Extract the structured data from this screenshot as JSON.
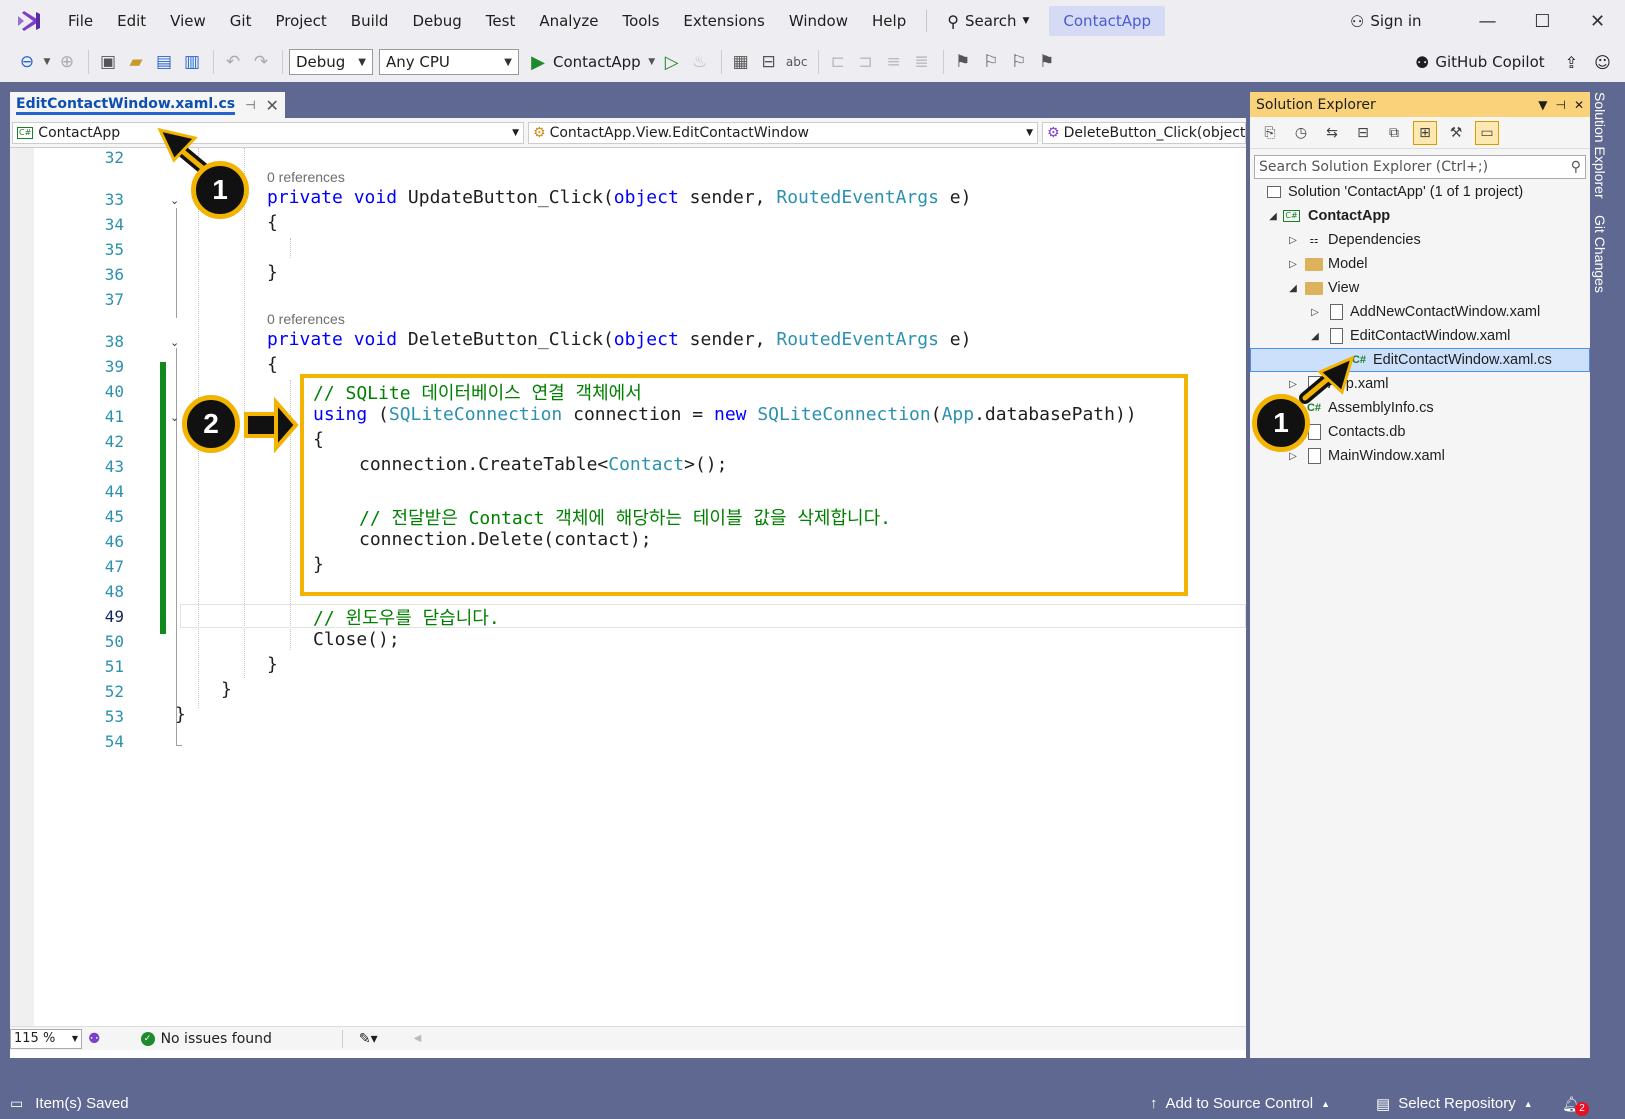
{
  "menu": [
    "File",
    "Edit",
    "View",
    "Git",
    "Project",
    "Build",
    "Debug",
    "Test",
    "Analyze",
    "Tools",
    "Extensions",
    "Window",
    "Help"
  ],
  "search": {
    "label": "Search"
  },
  "app_title": "ContactApp",
  "sign_in": "Sign in",
  "toolbar": {
    "config": "Debug",
    "platform": "Any CPU",
    "run_target": "ContactApp",
    "copilot": "GitHub Copilot"
  },
  "editor": {
    "tab_name": "EditContactWindow.xaml.cs",
    "nav_project": "ContactApp",
    "nav_class": "ContactApp.View.EditContactWindow",
    "nav_member": "DeleteButton_Click(object",
    "references_1": "0 references",
    "references_2": "0 references",
    "line_numbers": [
      "32",
      "33",
      "34",
      "35",
      "36",
      "37",
      "38",
      "39",
      "40",
      "41",
      "42",
      "43",
      "44",
      "45",
      "46",
      "47",
      "48",
      "49",
      "50",
      "51",
      "52",
      "53",
      "54"
    ],
    "lines": {
      "l33_a": "private void ",
      "l33_b": "UpdateButton_Click(",
      "l33_c": "object",
      "l33_d": " sender, ",
      "l33_e": "RoutedEventArgs",
      "l33_f": " e)",
      "l34": "{",
      "l36": "}",
      "l38_a": "private void ",
      "l38_b": "DeleteButton_Click(",
      "l38_c": "object",
      "l38_d": " sender, ",
      "l38_e": "RoutedEventArgs",
      "l38_f": " e)",
      "l39": "{",
      "l40": "// SQLite 데이터베이스 연결 객체에서",
      "l41_a": "using",
      "l41_b": " (",
      "l41_c": "SQLiteConnection",
      "l41_d": " connection = ",
      "l41_e": "new",
      "l41_f": " ",
      "l41_g": "SQLiteConnection",
      "l41_h": "(",
      "l41_i": "App",
      "l41_j": ".databasePath))",
      "l42": "{",
      "l43_a": "connection.CreateTable<",
      "l43_b": "Contact",
      "l43_c": ">();",
      "l45": "// 전달받은 Contact 객체에 해당하는 테이블 값을 삭제합니다.",
      "l46": "connection.Delete(contact);",
      "l47": "}",
      "l49": "// 윈도우를 닫습니다.",
      "l50": "Close();",
      "l51": "}",
      "l52": "}",
      "l53": "}"
    },
    "zoom": "115 %",
    "issues": "No issues found"
  },
  "solution_explorer": {
    "title": "Solution Explorer",
    "search_placeholder": "Search Solution Explorer (Ctrl+;)",
    "items": [
      {
        "label": "Solution 'ContactApp' (1 of 1 project)"
      },
      {
        "label": "ContactApp"
      },
      {
        "label": "Dependencies"
      },
      {
        "label": "Model"
      },
      {
        "label": "View"
      },
      {
        "label": "AddNewContactWindow.xaml"
      },
      {
        "label": "EditContactWindow.xaml"
      },
      {
        "label": "EditContactWindow.xaml.cs"
      },
      {
        "label": "App.xaml"
      },
      {
        "label": "AssemblyInfo.cs"
      },
      {
        "label": "Contacts.db"
      },
      {
        "label": "MainWindow.xaml"
      }
    ]
  },
  "side_tabs": [
    "Solution Explorer",
    "Git Changes"
  ],
  "statusbar": {
    "saved": "Item(s) Saved",
    "source_control": "Add to Source Control",
    "repository": "Select Repository",
    "notifications": "2"
  },
  "callouts": [
    "1",
    "2",
    "1"
  ],
  "colors": {
    "accent": "#f2b400",
    "frame": "#5e6890",
    "keyword": "#0000ff",
    "type": "#2b91af",
    "comment": "#008000"
  }
}
